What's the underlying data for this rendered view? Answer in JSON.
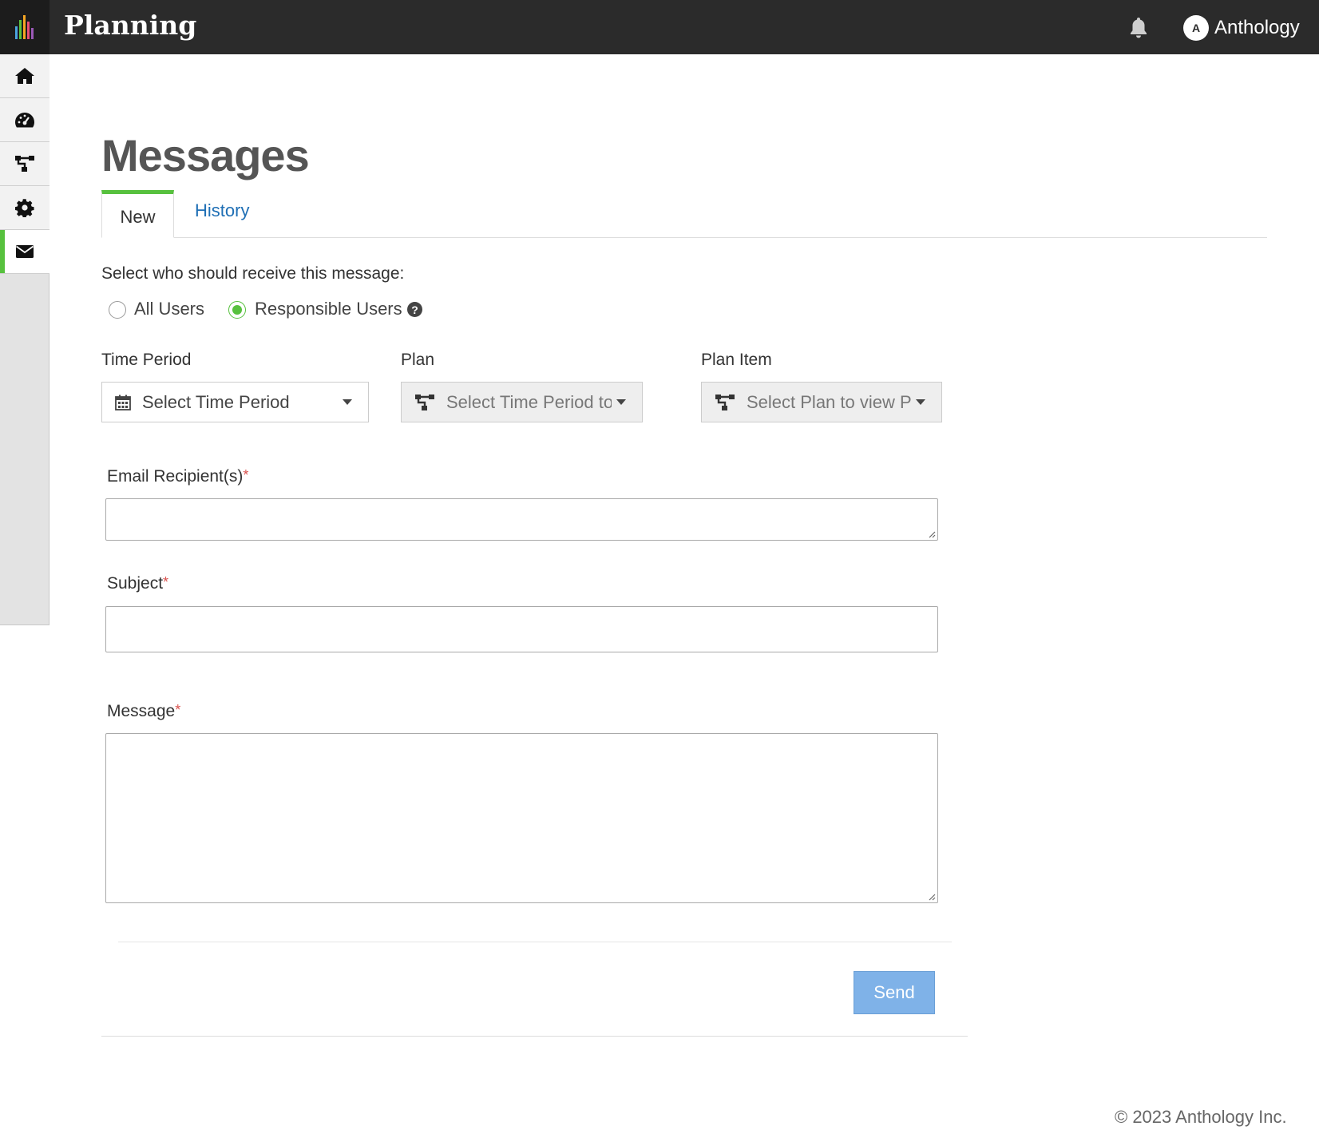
{
  "header": {
    "app_title": "Planning",
    "user_initial": "A",
    "user_name": "Anthology"
  },
  "sidebar": {
    "items": [
      {
        "name": "home",
        "icon": "home-icon",
        "active": false
      },
      {
        "name": "dashboard",
        "icon": "dashboard-icon",
        "active": false
      },
      {
        "name": "plans",
        "icon": "hierarchy-icon",
        "active": false
      },
      {
        "name": "settings",
        "icon": "gear-icon",
        "active": false
      },
      {
        "name": "messages",
        "icon": "envelope-icon",
        "active": true
      }
    ]
  },
  "page": {
    "title": "Messages",
    "tabs": [
      {
        "label": "New",
        "active": true
      },
      {
        "label": "History",
        "active": false
      }
    ]
  },
  "form": {
    "recipients_prompt": "Select who should receive this message:",
    "radio_all": "All Users",
    "radio_responsible": "Responsible Users",
    "selected_radio": "Responsible Users",
    "time_period_label": "Time Period",
    "time_period_value": "Select Time Period",
    "plan_label": "Plan",
    "plan_value": "Select Time Period to view Plans",
    "plan_item_label": "Plan Item",
    "plan_item_value": "Select Plan to view Plan Items",
    "email_label": "Email Recipient(s)",
    "email_value": "",
    "subject_label": "Subject",
    "subject_value": "",
    "message_label": "Message",
    "message_value": "",
    "required_marker": "*",
    "send_label": "Send"
  },
  "footer": {
    "copyright": "© 2023 Anthology Inc."
  },
  "colors": {
    "accent_green": "#57c13e",
    "link_blue": "#1f6fb5",
    "send_button": "#7fb2e8",
    "topbar": "#2b2b2b"
  }
}
